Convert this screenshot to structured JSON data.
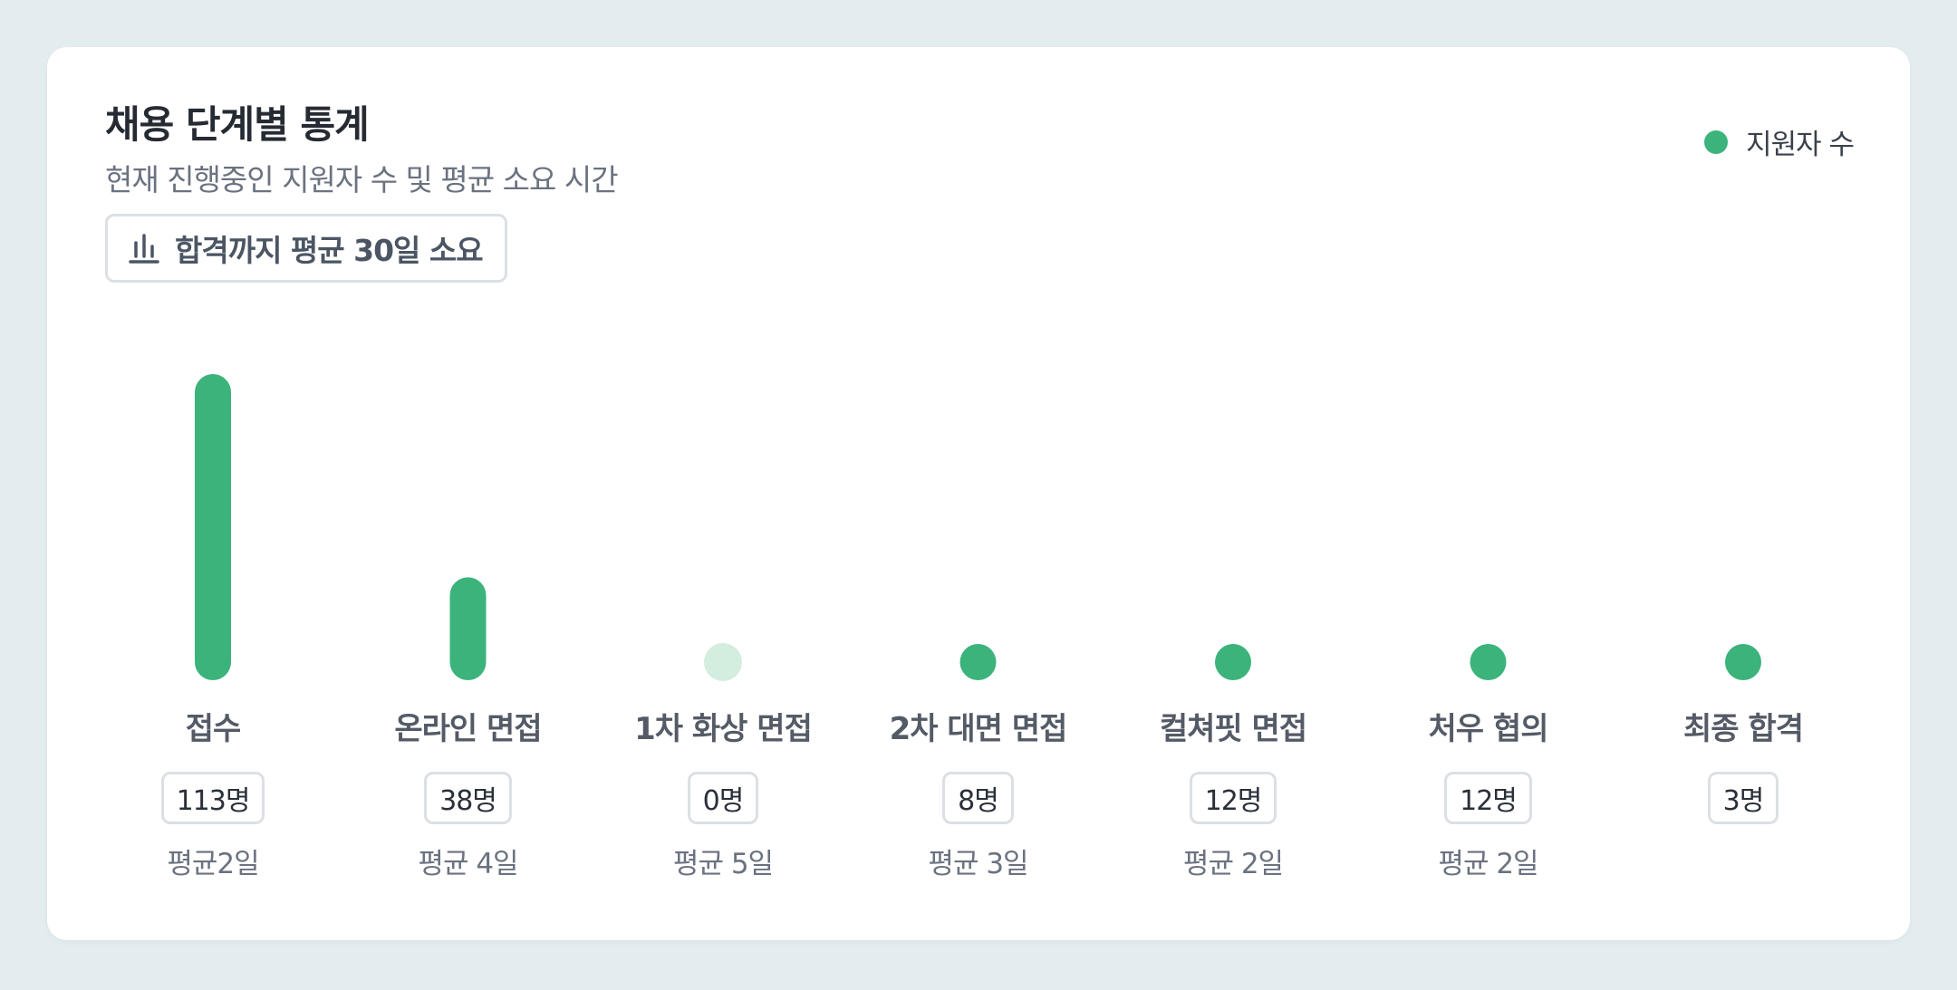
{
  "header": {
    "title": "채용 단계별 통계",
    "subtitle": "현재 진행중인 지원자 수 및 평균 소요 시간",
    "summary_label": "합격까지 평균 30일 소요",
    "summary_icon": "bar-chart-icon"
  },
  "legend": {
    "label": "지원자 수",
    "color": "#3bb37b"
  },
  "colors": {
    "bar": "#3bb37b",
    "bar_empty": "#d3eddf"
  },
  "chart_data": {
    "type": "bar",
    "categories": [
      "접수",
      "온라인 면접",
      "1차 화상 면접",
      "2차 대면 면접",
      "컬쳐핏 면접",
      "처우 협의",
      "최종 합격"
    ],
    "values": [
      113,
      38,
      0,
      8,
      12,
      12,
      3
    ],
    "value_labels": [
      "113명",
      "38명",
      "0명",
      "8명",
      "12명",
      "12명",
      "3명"
    ],
    "avg_labels": [
      "평균2일",
      "평균 4일",
      "평균 5일",
      "평균 3일",
      "평균 2일",
      "평균 2일",
      ""
    ],
    "series": [
      {
        "name": "지원자 수",
        "values": [
          113,
          38,
          0,
          8,
          12,
          12,
          3
        ]
      }
    ],
    "legend_position": "top-right",
    "grid": false
  }
}
